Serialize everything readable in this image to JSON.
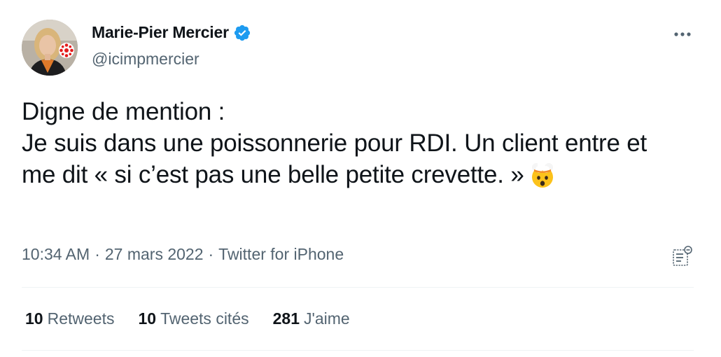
{
  "author": {
    "display_name": "Marie-Pier Mercier",
    "handle": "@icimpmercier",
    "verified": true,
    "avatar_icon": "profile-photo-with-radio-canada-logo"
  },
  "colors": {
    "verified_badge": "#1d9bf0",
    "muted_text": "#536471",
    "main_text": "#0f1419",
    "divider": "#eff3f4",
    "logo_red": "#e41c1c"
  },
  "tweet": {
    "text": "Digne de mention :\nJe suis dans une poissonnerie pour RDI. Un client entre et me dit « si c’est pas une belle petite crevette. »",
    "emoji": "exploding-head-emoji"
  },
  "meta": {
    "time": "10:34 AM",
    "date": "27 mars 2022",
    "source": "Twitter for iPhone",
    "separator": "·"
  },
  "stats": [
    {
      "count": "10",
      "label": "Retweets"
    },
    {
      "count": "10",
      "label": "Tweets cités"
    },
    {
      "count": "281",
      "label": "J'aime"
    }
  ]
}
